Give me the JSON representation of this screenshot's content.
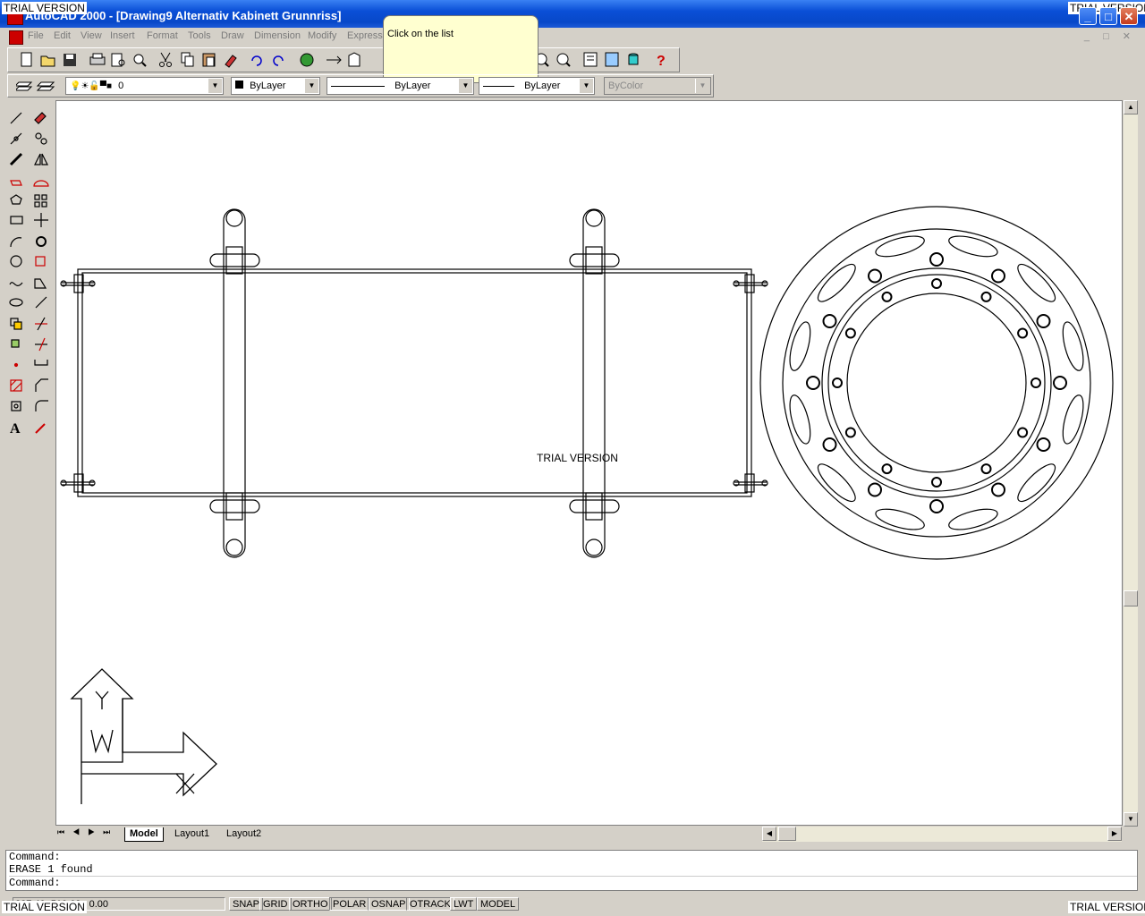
{
  "window": {
    "title": "AutoCAD 2000 - [Drawing9 Alternativ Kabinett Grunnriss]",
    "trial_watermark": "TRIAL VERSION",
    "controls": [
      "minimize-icon",
      "maximize-icon",
      "close-icon"
    ]
  },
  "menu": {
    "items": [
      "File",
      "Edit",
      "View",
      "Insert",
      "Format",
      "Tools",
      "Draw",
      "Dimension",
      "Modify",
      "Express"
    ]
  },
  "tooltip": {
    "text": "Click on the list"
  },
  "properties_toolbar": {
    "layer_value": "0",
    "color_value": "ByLayer",
    "linetype_value": "ByLayer",
    "lineweight_value": "ByLayer",
    "plotstyle_value": "ByColor"
  },
  "drawing": {
    "watermark": "TRIAL VERSION",
    "ucs_x": "X",
    "ucs_y": "Y",
    "ucs_w": "W"
  },
  "tabs": [
    "Model",
    "Layout1",
    "Layout2"
  ],
  "active_tab": "Model",
  "command": {
    "lines": [
      "Command:",
      "ERASE 1 found"
    ],
    "prompt": "Command:"
  },
  "status": {
    "coords": "227.40, 510.63 , 0.00",
    "buttons": [
      "SNAP",
      "GRID",
      "ORTHO",
      "POLAR",
      "OSNAP",
      "OTRACK",
      "LWT",
      "MODEL"
    ]
  },
  "colors": {
    "titlebar": "#0a4fd6",
    "tooltip_bg": "#ffffd0",
    "canvas_bg": "#ffffff"
  }
}
